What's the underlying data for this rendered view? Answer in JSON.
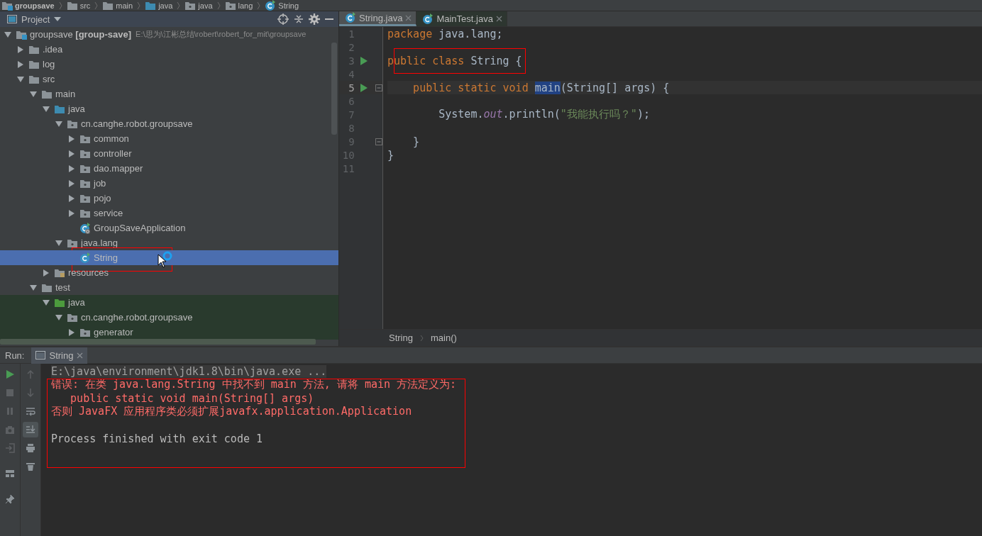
{
  "nav_bar": {
    "crumbs": [
      {
        "label": "groupsave",
        "kind": "module",
        "bold": true
      },
      {
        "label": "src",
        "kind": "folder",
        "bold": false
      },
      {
        "label": "main",
        "kind": "folder",
        "bold": false
      },
      {
        "label": "java",
        "kind": "source-folder",
        "bold": false
      },
      {
        "label": "java",
        "kind": "package",
        "bold": false
      },
      {
        "label": "lang",
        "kind": "package",
        "bold": false
      },
      {
        "label": "String",
        "kind": "class",
        "bold": false
      }
    ]
  },
  "project_panel": {
    "title": "Project",
    "tree": [
      {
        "label": "groupsave **[group-save]**",
        "path": "E:\\思为\\江彬总结\\robert\\robert_for_mit\\groupsave",
        "kind": "module",
        "expanded": true,
        "selected": false,
        "boxed": false,
        "tinted": false,
        "children": [
          {
            "label": ".idea",
            "kind": "folder",
            "expanded": false,
            "selected": false,
            "boxed": false,
            "tinted": false
          },
          {
            "label": "log",
            "kind": "folder",
            "expanded": false,
            "selected": false,
            "boxed": false,
            "tinted": false
          },
          {
            "label": "src",
            "kind": "folder",
            "expanded": true,
            "selected": false,
            "boxed": false,
            "tinted": false,
            "children": [
              {
                "label": "main",
                "kind": "folder",
                "expanded": true,
                "selected": false,
                "boxed": false,
                "tinted": false,
                "children": [
                  {
                    "label": "java",
                    "kind": "source-folder",
                    "expanded": true,
                    "selected": false,
                    "boxed": false,
                    "tinted": false,
                    "children": [
                      {
                        "label": "cn.canghe.robot.groupsave",
                        "kind": "package",
                        "expanded": true,
                        "selected": false,
                        "boxed": false,
                        "tinted": false,
                        "children": [
                          {
                            "label": "common",
                            "kind": "package",
                            "expanded": false,
                            "selected": false,
                            "boxed": false,
                            "tinted": false
                          },
                          {
                            "label": "controller",
                            "kind": "package",
                            "expanded": false,
                            "selected": false,
                            "boxed": false,
                            "tinted": false
                          },
                          {
                            "label": "dao.mapper",
                            "kind": "package",
                            "expanded": false,
                            "selected": false,
                            "boxed": false,
                            "tinted": false
                          },
                          {
                            "label": "job",
                            "kind": "package",
                            "expanded": false,
                            "selected": false,
                            "boxed": false,
                            "tinted": false
                          },
                          {
                            "label": "pojo",
                            "kind": "package",
                            "expanded": false,
                            "selected": false,
                            "boxed": false,
                            "tinted": false
                          },
                          {
                            "label": "service",
                            "kind": "package",
                            "expanded": false,
                            "selected": false,
                            "boxed": false,
                            "tinted": false
                          },
                          {
                            "label": "GroupSaveApplication",
                            "kind": "spring-class",
                            "selected": false,
                            "boxed": false,
                            "tinted": false
                          }
                        ]
                      },
                      {
                        "label": "java.lang",
                        "kind": "package",
                        "expanded": true,
                        "selected": false,
                        "boxed": false,
                        "tinted": false,
                        "children": [
                          {
                            "label": "String",
                            "kind": "class",
                            "selected": true,
                            "boxed": true,
                            "tinted": false
                          }
                        ]
                      }
                    ]
                  },
                  {
                    "label": "resources",
                    "kind": "resources",
                    "expanded": false,
                    "selected": false,
                    "boxed": false,
                    "tinted": false
                  }
                ]
              },
              {
                "label": "test",
                "kind": "folder",
                "expanded": true,
                "selected": false,
                "boxed": false,
                "tinted": false,
                "children": [
                  {
                    "label": "java",
                    "kind": "test-folder",
                    "expanded": true,
                    "selected": false,
                    "boxed": false,
                    "tinted": true,
                    "children": [
                      {
                        "label": "cn.canghe.robot.groupsave",
                        "kind": "package",
                        "expanded": true,
                        "selected": false,
                        "boxed": false,
                        "tinted": true,
                        "children": [
                          {
                            "label": "generator",
                            "kind": "package",
                            "expanded": false,
                            "selected": false,
                            "boxed": false,
                            "tinted": true
                          }
                        ]
                      }
                    ]
                  }
                ]
              }
            ]
          }
        ]
      }
    ]
  },
  "editor": {
    "tabs": [
      {
        "label": "String.java",
        "selected": true
      },
      {
        "label": "MainTest.java",
        "selected": false
      }
    ],
    "lines": [
      {
        "number": "1",
        "run_marker": false,
        "fold": false,
        "current": false,
        "boxed": false,
        "tokens": [
          {
            "kind": "keyword",
            "text": "package"
          },
          {
            "kind": "plain",
            "text": " java.lang;"
          }
        ]
      },
      {
        "number": "2",
        "run_marker": false,
        "fold": false,
        "current": false,
        "boxed": false
      },
      {
        "number": "3",
        "run_marker": true,
        "fold": false,
        "current": false,
        "boxed": true,
        "tokens": [
          {
            "kind": "keyword",
            "text": "public class"
          },
          {
            "kind": "plain",
            "text": " String {"
          }
        ]
      },
      {
        "number": "4",
        "run_marker": false,
        "fold": false,
        "current": false,
        "boxed": false
      },
      {
        "number": "5",
        "run_marker": true,
        "fold": true,
        "current": true,
        "boxed": false,
        "tokens": [
          {
            "kind": "keyword",
            "text": "    public static void "
          },
          {
            "kind": "usage",
            "text": "main"
          },
          {
            "kind": "plain",
            "text": "(String[] args) {"
          }
        ]
      },
      {
        "number": "6",
        "run_marker": false,
        "fold": false,
        "current": false,
        "boxed": false
      },
      {
        "number": "7",
        "run_marker": false,
        "fold": false,
        "current": false,
        "boxed": false,
        "tokens": [
          {
            "kind": "plain",
            "text": "        System."
          },
          {
            "kind": "field",
            "text": "out"
          },
          {
            "kind": "plain",
            "text": ".println("
          },
          {
            "kind": "string",
            "text": "\"我能执行吗？\""
          },
          {
            "kind": "plain",
            "text": ");"
          }
        ]
      },
      {
        "number": "8",
        "run_marker": false,
        "fold": false,
        "current": false,
        "boxed": false
      },
      {
        "number": "9",
        "run_marker": false,
        "fold": true,
        "current": false,
        "boxed": false,
        "tokens": [
          {
            "kind": "plain",
            "text": "    }"
          }
        ]
      },
      {
        "number": "10",
        "run_marker": false,
        "fold": false,
        "current": false,
        "boxed": false,
        "tokens": [
          {
            "kind": "plain",
            "text": "}"
          }
        ]
      },
      {
        "number": "11",
        "run_marker": false,
        "fold": false,
        "current": false,
        "boxed": false
      }
    ],
    "breadcrumb": [
      "String",
      "main()"
    ]
  },
  "run_panel": {
    "label": "Run:",
    "tab": "String",
    "console": {
      "boxed": true,
      "lines": [
        {
          "kind": "command",
          "text": "E:\\java\\environment\\jdk1.8\\bin\\java.exe ..."
        },
        {
          "kind": "error",
          "text": "错误: 在类 java.lang.String 中找不到 main 方法, 请将 main 方法定义为:"
        },
        {
          "kind": "error",
          "text": "   public static void main(String[] args)"
        },
        {
          "kind": "error",
          "text": "否则 JavaFX 应用程序类必须扩展javafx.application.Application"
        },
        {
          "kind": "blank"
        },
        {
          "kind": "normal",
          "text": "Process finished with exit code 1"
        }
      ]
    }
  }
}
